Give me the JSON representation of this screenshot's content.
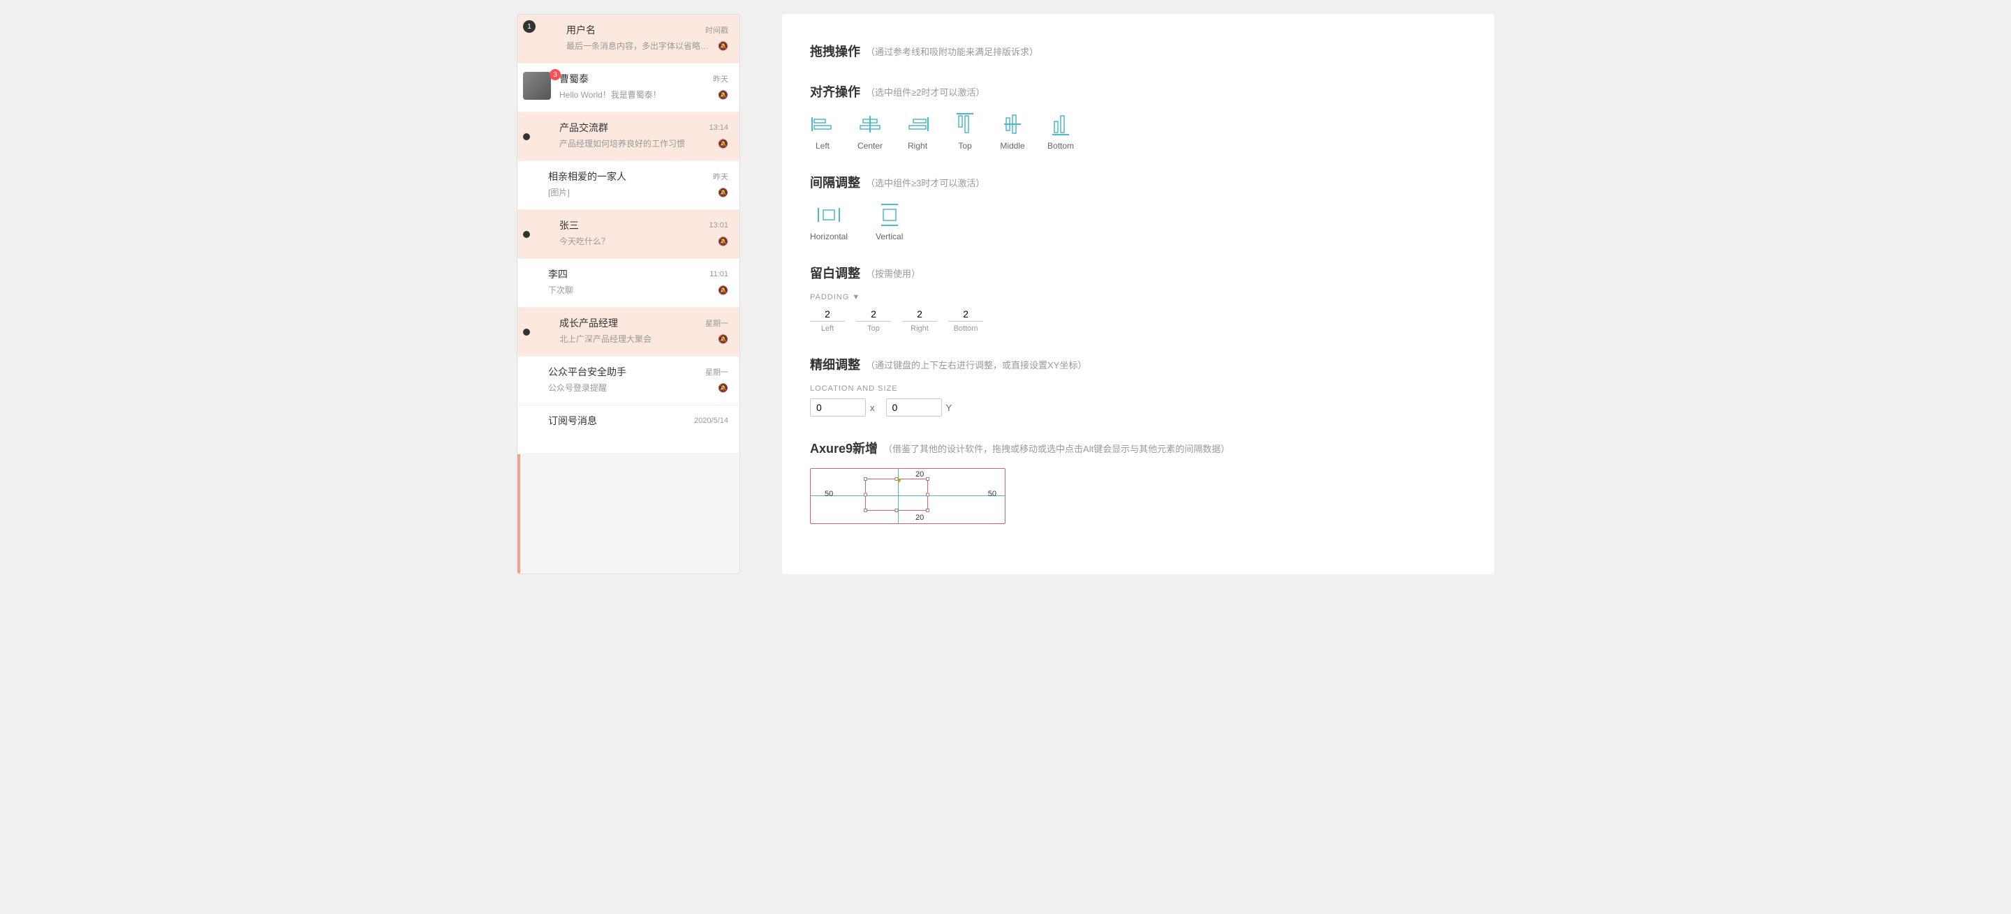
{
  "chat": {
    "items": [
      {
        "name": "用户名",
        "time": "时间戳",
        "preview": "最后一条消息内容，多出字体以省略号代替…",
        "muted": true,
        "badge": "1",
        "highlighted": true,
        "type": "badge"
      },
      {
        "name": "曹蜀泰",
        "time": "昨天",
        "preview": "Hello World！我是曹蜀泰！",
        "muted": true,
        "badge": "3",
        "highlighted": false,
        "type": "avatar"
      },
      {
        "name": "产品交流群",
        "time": "13:14",
        "preview": "产品经理如何培养良好的工作习惯",
        "muted": true,
        "badge": null,
        "highlighted": true,
        "type": "dot"
      },
      {
        "name": "相亲相爱的一家人",
        "time": "昨天",
        "preview": "[图片]",
        "muted": true,
        "badge": null,
        "highlighted": false,
        "type": "none"
      },
      {
        "name": "张三",
        "time": "13:01",
        "preview": "今天吃什么？",
        "muted": true,
        "badge": null,
        "highlighted": true,
        "type": "dot"
      },
      {
        "name": "李四",
        "time": "11:01",
        "preview": "下次聊",
        "muted": true,
        "badge": null,
        "highlighted": false,
        "type": "none"
      },
      {
        "name": "成长产品经理",
        "time": "星期一",
        "preview": "北上广深产品经理大聚会",
        "muted": true,
        "badge": null,
        "highlighted": true,
        "type": "dot"
      },
      {
        "name": "公众平台安全助手",
        "time": "星期一",
        "preview": "公众号登录提醒",
        "muted": true,
        "badge": null,
        "highlighted": false,
        "type": "none"
      },
      {
        "name": "订阅号消息",
        "time": "2020/5/14",
        "preview": "",
        "muted": false,
        "badge": null,
        "highlighted": false,
        "type": "none"
      }
    ]
  },
  "settings": {
    "drag_title": "拖拽操作",
    "drag_subtitle": "（通过参考线和吸附功能来满足排版诉求）",
    "align_title": "对齐操作",
    "align_subtitle": "（选中组件≥2时才可以激活）",
    "align_items": [
      {
        "label": "Left",
        "icon": "align-left"
      },
      {
        "label": "Center",
        "icon": "align-center"
      },
      {
        "label": "Right",
        "icon": "align-right"
      },
      {
        "label": "Top",
        "icon": "align-top"
      },
      {
        "label": "Middle",
        "icon": "align-middle"
      },
      {
        "label": "Bottom",
        "icon": "align-bottom"
      }
    ],
    "spacing_title": "间隔调整",
    "spacing_subtitle": "（选中组件≥3时才可以激活）",
    "spacing_items": [
      {
        "label": "Horizontal",
        "icon": "distribute-horizontal"
      },
      {
        "label": "Vertical",
        "icon": "distribute-vertical"
      }
    ],
    "padding_title": "留白调整",
    "padding_subtitle": "（按需使用）",
    "padding_label": "PADDING ▼",
    "padding": {
      "left": "2",
      "top": "2",
      "right": "2",
      "bottom": "2"
    },
    "padding_labels": [
      "Left",
      "Top",
      "Right",
      "Bottom"
    ],
    "fine_title": "精细调整",
    "fine_subtitle": "（通过键盘的上下左右进行调整，或直接设置XY坐标）",
    "location_label": "LOCATION AND SIZE",
    "location": {
      "x": "0",
      "y": "0"
    },
    "axure_title": "Axure9新增",
    "axure_subtitle": "（借鉴了其他的设计软件，拖拽或移动或选中点击Alt键会显示与其他元素的间隔数据）",
    "axure_nums": {
      "top": "20",
      "bottom": "20",
      "left": "50",
      "right": "50"
    }
  }
}
